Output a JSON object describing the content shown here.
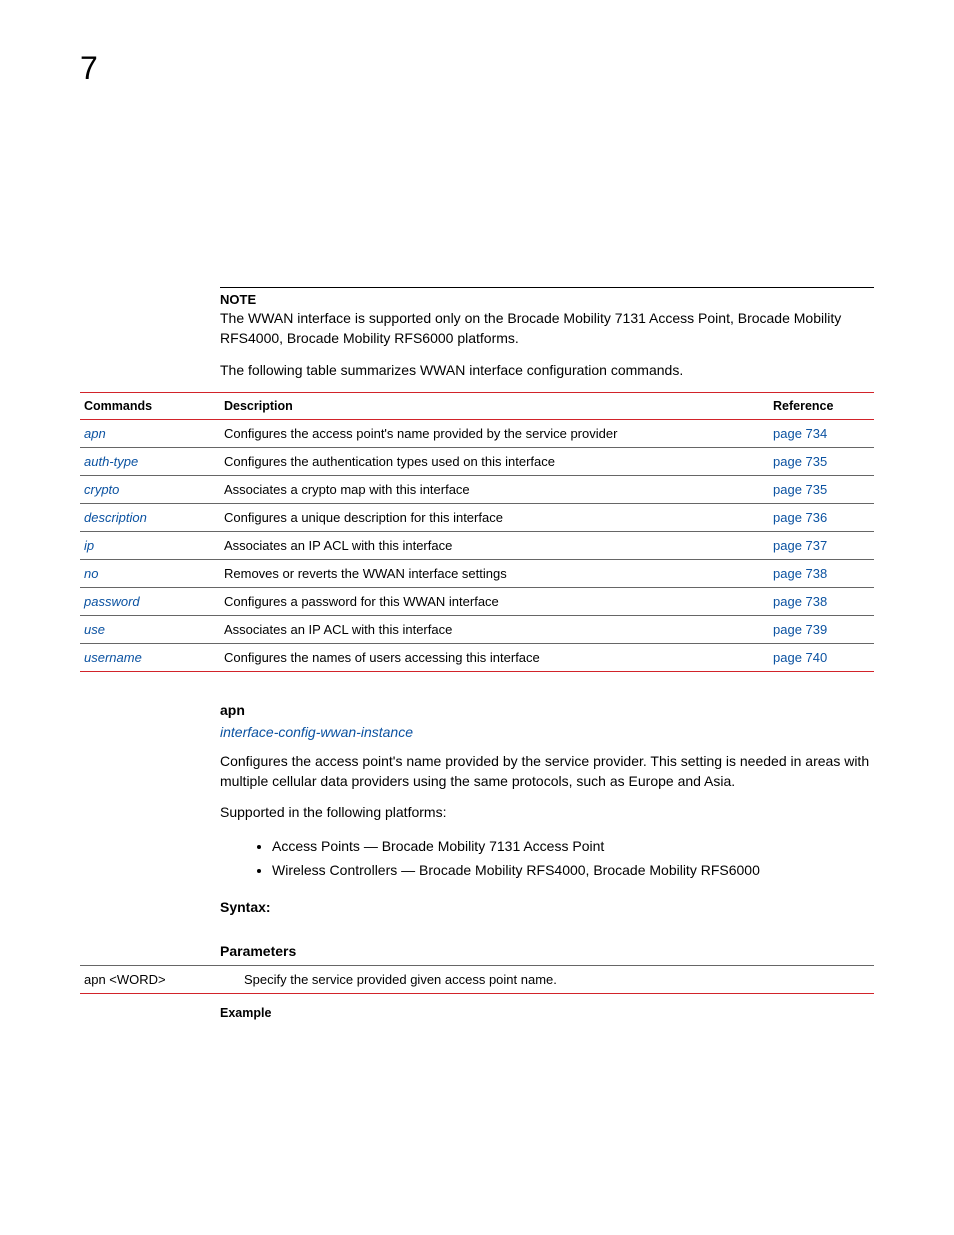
{
  "page_number": "7",
  "note_label": "NOTE",
  "note_body": "The WWAN interface is supported only on the Brocade Mobility 7131 Access Point, Brocade Mobility RFS4000, Brocade Mobility RFS6000 platforms.",
  "intro": "The following table summarizes WWAN interface configuration commands.",
  "table": {
    "headers": {
      "commands": "Commands",
      "description": "Description",
      "reference": "Reference"
    },
    "rows": [
      {
        "cmd": "apn",
        "desc": "Configures the access point's name provided by the service provider",
        "ref": "page 734"
      },
      {
        "cmd": "auth-type",
        "desc": "Configures the authentication types used on this interface",
        "ref": "page 735"
      },
      {
        "cmd": "crypto",
        "desc": "Associates a crypto map with this interface",
        "ref": "page 735"
      },
      {
        "cmd": "description",
        "desc": "Configures a unique description for this interface",
        "ref": "page 736"
      },
      {
        "cmd": "ip",
        "desc": "Associates an IP ACL with this interface",
        "ref": "page 737"
      },
      {
        "cmd": "no",
        "desc": "Removes or reverts the WWAN interface settings",
        "ref": "page 738"
      },
      {
        "cmd": "password",
        "desc": "Configures a password for this WWAN interface",
        "ref": "page 738"
      },
      {
        "cmd": "use",
        "desc": "Associates an IP ACL with this interface",
        "ref": "page 739"
      },
      {
        "cmd": "username",
        "desc": "Configures the names of users accessing this interface",
        "ref": "page 740"
      }
    ]
  },
  "apn": {
    "heading": "apn",
    "sublink": "interface-config-wwan-instance",
    "body": "Configures the access point's name provided by the service provider. This setting is needed in areas with multiple cellular data providers using the same protocols, such as Europe and Asia.",
    "supported_intro": "Supported in the following platforms:",
    "platforms": [
      "Access Points — Brocade Mobility 7131 Access Point",
      "Wireless Controllers — Brocade Mobility RFS4000, Brocade Mobility RFS6000"
    ],
    "syntax_label": "Syntax:",
    "parameters_label": "Parameters",
    "params_row": {
      "param": "apn <WORD>",
      "desc": "Specify the service provided given access point name."
    },
    "example_label": "Example"
  }
}
